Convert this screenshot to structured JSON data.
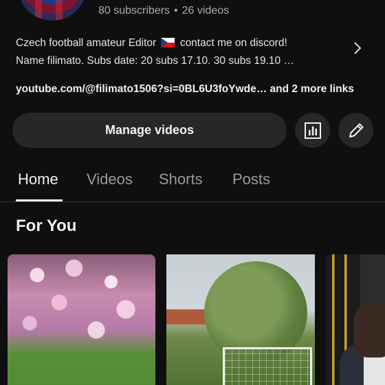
{
  "channel": {
    "subscribers": "80 subscribers",
    "separator": "•",
    "videos": "26 videos"
  },
  "description": {
    "line1_before_flag": "Czech football amateur Editor",
    "line1_after_flag": "contact me on discord!",
    "line2": "Name filimato.   Subs date: 20 subs 17.10.     30 subs 19.10 …",
    "flag_icon": "czech-flag-icon"
  },
  "links": {
    "text": "youtube.com/@filimato1506?si=0BL6U3foYwde… and 2 more links"
  },
  "actions": {
    "manage_videos": "Manage videos",
    "analytics_icon": "bar-chart-icon",
    "edit_icon": "pencil-icon"
  },
  "tabs": [
    {
      "label": "Home",
      "active": true
    },
    {
      "label": "Videos",
      "active": false
    },
    {
      "label": "Shorts",
      "active": false
    },
    {
      "label": "Posts",
      "active": false
    }
  ],
  "section": {
    "title": "For You"
  },
  "colors": {
    "background": "#0f0f0f",
    "button": "#272727",
    "text": "#f1f1f1",
    "muted": "#aaaaaa"
  }
}
